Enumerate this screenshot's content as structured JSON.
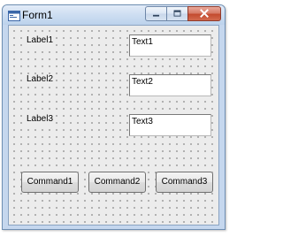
{
  "window": {
    "title": "Form1",
    "icon": "form-icon"
  },
  "caption_buttons": [
    {
      "name": "minimize",
      "icon": "minimize-icon"
    },
    {
      "name": "maximize",
      "icon": "maximize-icon"
    },
    {
      "name": "close",
      "icon": "close-icon"
    }
  ],
  "form": {
    "labels": [
      "Label1",
      "Label2",
      "Label3"
    ],
    "textboxes": [
      "Text1",
      "Text2",
      "Text3"
    ],
    "commands": [
      "Command1",
      "Command2",
      "Command3"
    ]
  },
  "colors": {
    "client_background": "#ececec",
    "grid_dots": "#000000",
    "titlebar": "#c5d7ee",
    "close_button": "#c44b2f"
  }
}
